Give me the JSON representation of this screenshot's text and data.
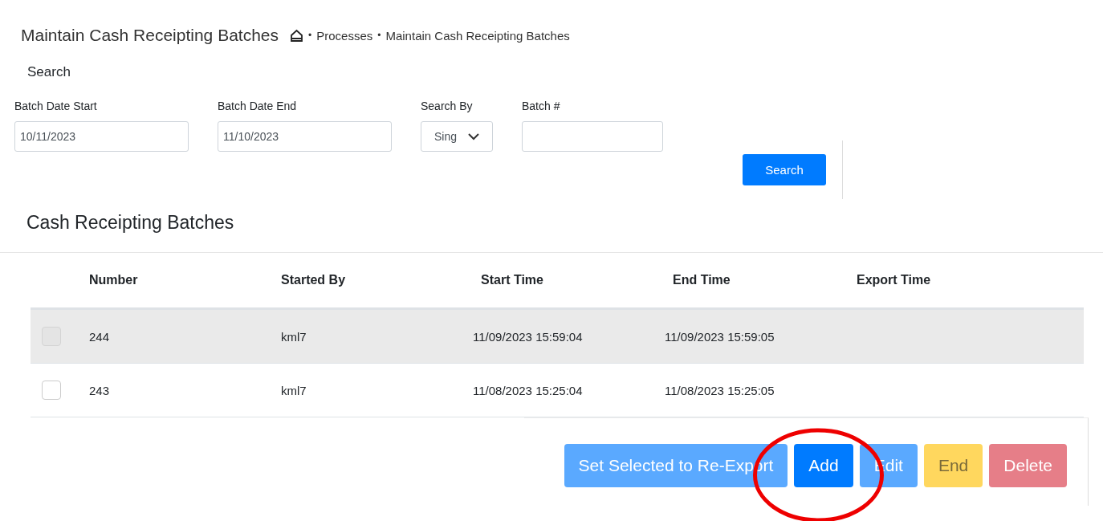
{
  "header": {
    "title": "Maintain Cash Receipting Batches",
    "breadcrumb": [
      "Processes",
      "Maintain Cash Receipting Batches"
    ],
    "separator": "•"
  },
  "search": {
    "title": "Search",
    "fields": [
      {
        "kind": "text",
        "label": "Batch Date Start",
        "value": "10/11/2023"
      },
      {
        "kind": "text",
        "label": "Batch Date End",
        "value": "11/10/2023"
      },
      {
        "kind": "select",
        "label": "Search By",
        "value": "Sing"
      },
      {
        "kind": "text",
        "label": "Batch #"
      }
    ],
    "button": "Search"
  },
  "table": {
    "title": "Cash Receipting Batches",
    "columns": [
      "Number",
      "Started By",
      "Start Time",
      "End Time",
      "Export Time"
    ],
    "rows": [
      {
        "selected": true,
        "checked": false,
        "cells": [
          "244",
          "kml7",
          "11/09/2023 15:59:04",
          "11/09/2023 15:59:05",
          ""
        ]
      },
      {
        "selected": false,
        "checked": false,
        "cells": [
          "243",
          "kml7",
          "11/08/2023 15:25:04",
          "11/08/2023 15:25:05",
          ""
        ]
      }
    ]
  },
  "actions": [
    {
      "label": "Set Selected to Re-Export",
      "kind": "primary",
      "disabled": true
    },
    {
      "label": "Add",
      "kind": "primary",
      "disabled": false
    },
    {
      "label": "Edit",
      "kind": "primary",
      "disabled": true
    },
    {
      "label": "End",
      "kind": "warning",
      "disabled": true
    },
    {
      "label": "Delete",
      "kind": "danger",
      "disabled": true
    }
  ]
}
